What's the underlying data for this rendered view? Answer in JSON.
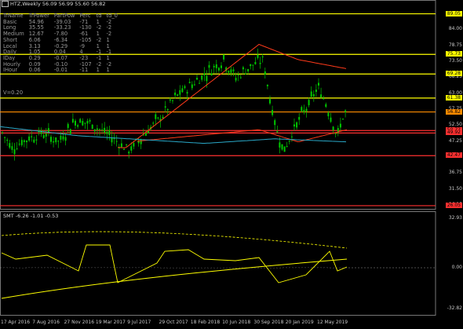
{
  "header": {
    "symbol": "HTZ,Weekly",
    "ohlc": "56.09 56.99 55.60 56.82"
  },
  "stats": {
    "columns": [
      "TrName",
      "TrPower",
      "PartPow",
      "Perc",
      "td",
      "td_0"
    ],
    "rows": [
      [
        "Basic",
        "54.96",
        "-39.03",
        "-71",
        "1",
        "-2"
      ],
      [
        "Long",
        "35.55",
        "-33.23",
        "-130",
        "-2",
        "-2"
      ],
      [
        "Medium",
        "12.67",
        "-7.80",
        "-61",
        "1",
        "-2"
      ],
      [
        "Short",
        "6.06",
        "-6.34",
        "-105",
        "-2",
        "1"
      ],
      [
        "Local",
        "3.13",
        "-0.29",
        "-9",
        "1",
        "1"
      ],
      [
        "Daily",
        "1.05",
        "0.04",
        "4",
        "-1",
        "-1"
      ],
      [
        "IDay",
        "0.29",
        "-0.07",
        "-23",
        "-1",
        "1"
      ],
      [
        "Hourly",
        "0.09",
        "-0.10",
        "-107",
        "-2",
        "-2"
      ],
      [
        "IHour",
        "0.06",
        "-0.01",
        "-11",
        "1",
        "1"
      ]
    ],
    "volatility": "V=0.20"
  },
  "price_axis": [
    "84.00",
    "78.75",
    "73.50",
    "68.25",
    "63.00",
    "57.75",
    "52.50",
    "47.25",
    "42.00",
    "36.75",
    "31.50",
    "26.25"
  ],
  "price_tags": [
    {
      "label": "89.05",
      "color": "#ffff00",
      "value": 89.05
    },
    {
      "label": "75.73",
      "color": "#ffff00",
      "value": 75.73
    },
    {
      "label": "69.28",
      "color": "#ffff00",
      "value": 69.28
    },
    {
      "label": "61.38",
      "color": "#ffff00",
      "value": 61.38
    },
    {
      "label": "56.82",
      "color": "#ff8c00",
      "value": 56.82
    },
    {
      "label": "50.72",
      "color": "#ff3030",
      "value": 50.72
    },
    {
      "label": "49.92",
      "color": "#ff3030",
      "value": 49.92
    },
    {
      "label": "42.47",
      "color": "#ff3030",
      "value": 42.47
    },
    {
      "label": "26.05",
      "color": "#ff3030",
      "value": 26.05
    }
  ],
  "sub_window": {
    "title": "SMT -6.26 -1.01 -0.53",
    "axis": [
      "32.93",
      "0.00",
      "-32.82"
    ]
  },
  "time_axis": [
    "17 Apr 2016",
    "7 Aug 2016",
    "27 Nov 2016",
    "19 Mar 2017",
    "9 Jul 2017",
    "29 Oct 2017",
    "18 Feb 2018",
    "10 Jun 2018",
    "30 Sep 2018",
    "20 Jan 2019",
    "12 May 2019"
  ],
  "colors": {
    "bull_candle": "#00c800",
    "bear_candle": "#00c800",
    "ma_fast": "#ff3a1a",
    "ma_slow": "#2aa8c8",
    "support": "#ff3030",
    "resistance": "#ffff00"
  }
}
